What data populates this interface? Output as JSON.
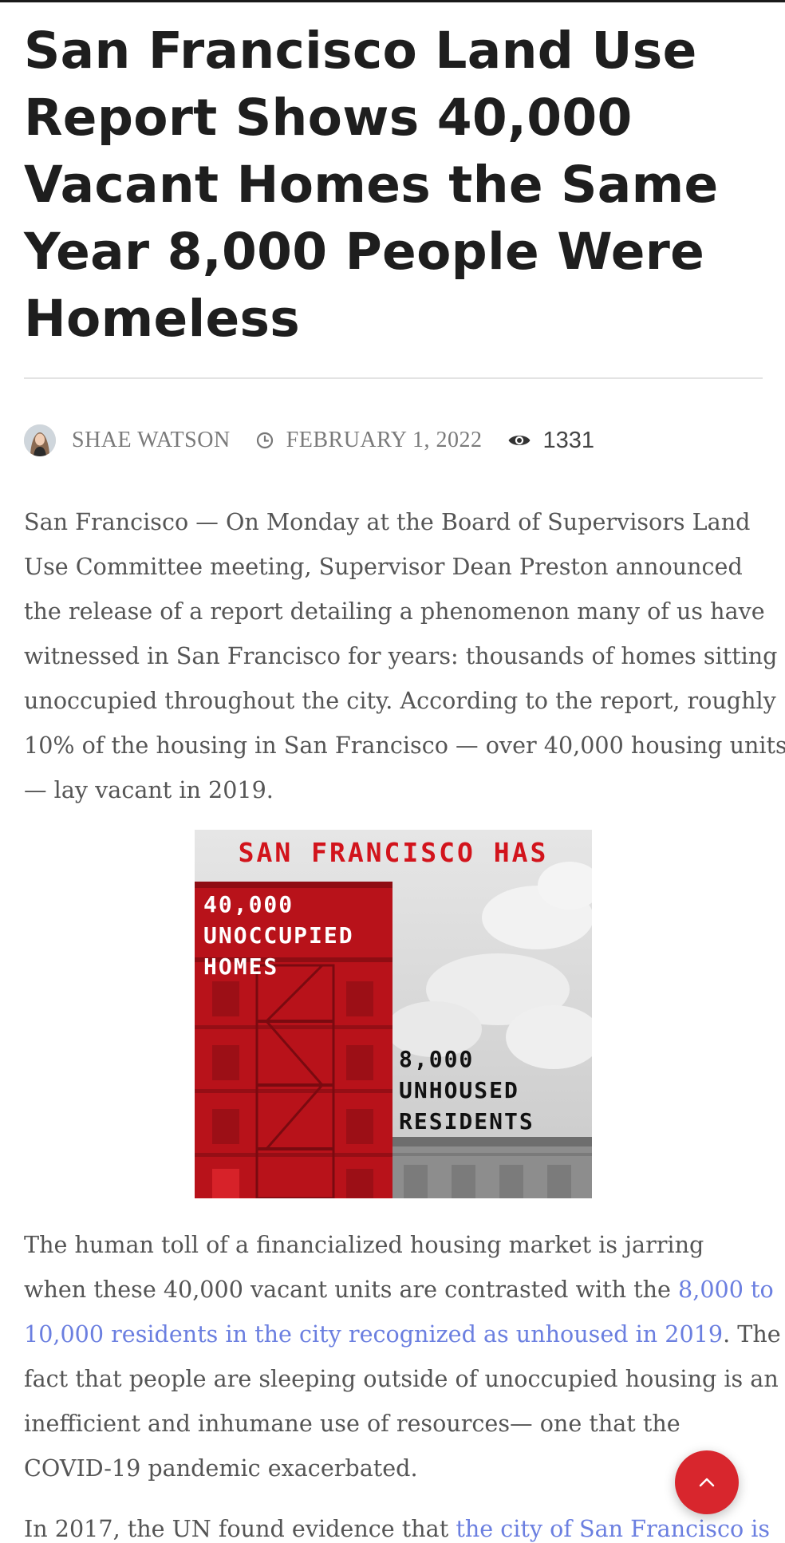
{
  "article": {
    "title": "San Francisco Land Use Report Shows 40,000 Vacant Homes the Same Year 8,000 People Were Homeless",
    "author": "SHAE WATSON",
    "date": "FEBRUARY 1, 2022",
    "views": "1331"
  },
  "body": {
    "p1": [
      "San Francisco — On Monday at the Board of Supervisors Land",
      "Use Committee meeting, Supervisor Dean Preston announced",
      "the release of a report detailing a phenomenon many of us have",
      "witnessed in San Francisco for years: thousands of homes sitting",
      "unoccupied throughout the city. According to the report, roughly",
      "10% of the housing in San Francisco — over 40,000 housing units",
      "— lay vacant in 2019."
    ],
    "p2": {
      "line1": "The human toll of a financialized housing market is jarring",
      "line2_text": "when these 40,000 vacant units are contrasted with the ",
      "line2_link": "8,000 to",
      "line3_link": "10,000 residents in the city recognized as unhoused in 2019",
      "line3_text": ". The",
      "line4": "fact that people are sleeping outside of unoccupied housing is an",
      "line5": "inefficient and inhumane use of resources— one that the",
      "line6": "COVID-19 pandemic exacerbated."
    },
    "p3": {
      "text": "In 2017, the UN found evidence that ",
      "link": "the city of San Francisco is"
    }
  },
  "figure": {
    "heading": "SAN FRANCISCO HAS",
    "left_lines": [
      "40,000",
      "UNOCCUPIED",
      "HOMES"
    ],
    "right_lines": [
      "8,000",
      "UNHOUSED",
      "RESIDENTS"
    ]
  },
  "icons": {
    "avatar": "author-avatar",
    "clock": "clock-icon",
    "eye": "eye-icon",
    "scroll_top": "chevron-up-icon"
  },
  "colors": {
    "accent": "#d8262d",
    "link": "#6b7fe0",
    "figure_red": "#c4141c"
  }
}
